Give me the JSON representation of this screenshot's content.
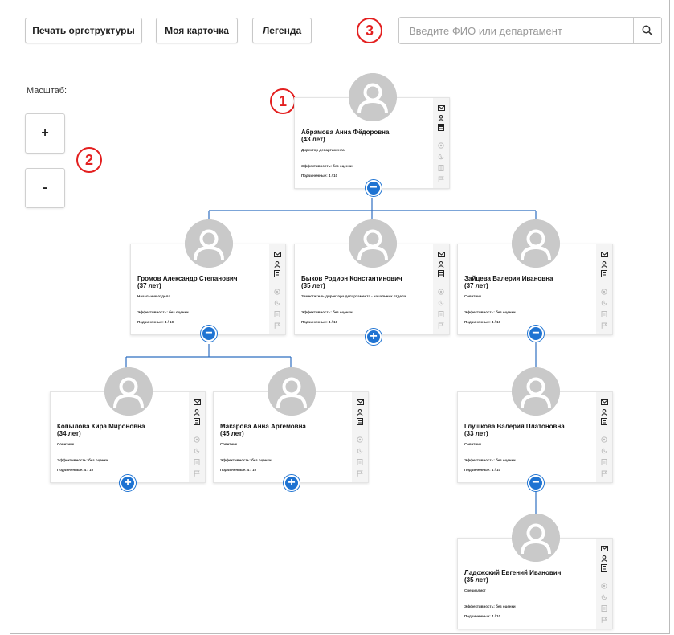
{
  "toolbar": {
    "print_label": "Печать оргструктуры",
    "my_card_label": "Моя карточка",
    "legend_label": "Легенда",
    "search_placeholder": "Введите ФИО или департамент"
  },
  "scale": {
    "label": "Масштаб:",
    "zoom_in": "+",
    "zoom_out": "-"
  },
  "callouts": [
    "1",
    "2",
    "3"
  ],
  "colors": {
    "accent": "#1e73d2",
    "callout": "#e32020",
    "connector": "#2f6fc0"
  },
  "toggle_symbols": {
    "expanded": "−",
    "collapsed": "+"
  },
  "cards": [
    {
      "name": "Абрамова Анна Фёдоровна",
      "age": "(43 лет)",
      "position": "Директор департамента",
      "efficiency": "Эффективность: без оценки",
      "subordinates": "Подчиненные: 4 / 10",
      "toggle": "expanded"
    },
    {
      "name": "Громов Александр Степанович",
      "age": "(37 лет)",
      "position": "Начальник отдела",
      "efficiency": "Эффективность: без оценки",
      "subordinates": "Подчиненные: 4 / 10",
      "toggle": "expanded"
    },
    {
      "name": "Быков Родион Константинович",
      "age": "(35 лет)",
      "position": "Заместитель директора департамента - начальник отдела",
      "efficiency": "Эффективность: без оценки",
      "subordinates": "Подчиненные: 4 / 10",
      "toggle": "collapsed"
    },
    {
      "name": "Зайцева Валерия Ивановна",
      "age": "(37 лет)",
      "position": "Советник",
      "efficiency": "Эффективность: без оценки",
      "subordinates": "Подчиненные: 4 / 10",
      "toggle": "expanded"
    },
    {
      "name": "Копылова Кира Мироновна",
      "age": "(34 лет)",
      "position": "Советник",
      "efficiency": "Эффективность: без оценки",
      "subordinates": "Подчиненные: 4 / 10",
      "toggle": "collapsed"
    },
    {
      "name": "Макарова Анна Артёмовна",
      "age": "(45 лет)",
      "position": "Советник",
      "efficiency": "Эффективность: без оценки",
      "subordinates": "Подчиненные: 4 / 10",
      "toggle": "collapsed"
    },
    {
      "name": "Глушкова Валерия Платоновна",
      "age": "(33 лет)",
      "position": "Советник",
      "efficiency": "Эффективность: без оценки",
      "subordinates": "Подчиненные: 4 / 10",
      "toggle": "expanded"
    },
    {
      "name": "Ладожский Евгений Иванович",
      "age": "(35 лет)",
      "position": "Специалист",
      "efficiency": "Эффективность: без оценки",
      "subordinates": "Подчиненные: 4 / 10",
      "toggle": null
    }
  ]
}
